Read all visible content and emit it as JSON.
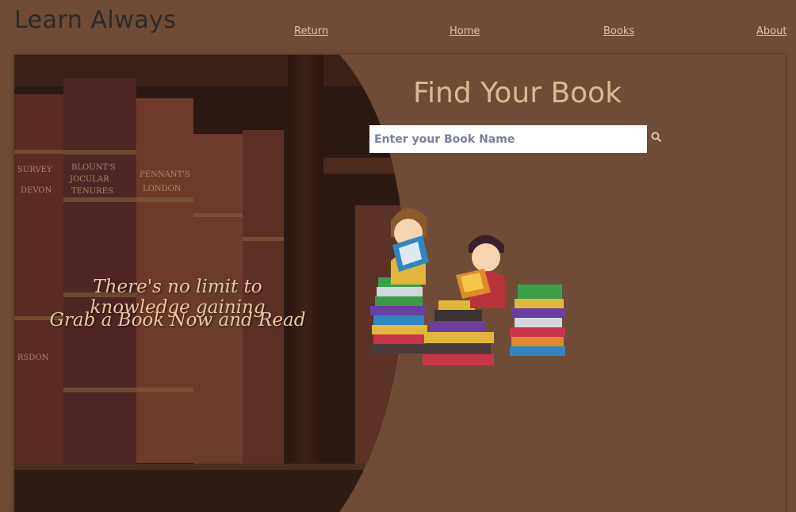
{
  "brand": "Learn Always",
  "nav": {
    "return": "Return",
    "home": "Home",
    "books": "Books",
    "about": "About"
  },
  "hero": {
    "line1": "There's no limit to knowledge gaining",
    "line2": "Grab a Book Now and Read"
  },
  "search": {
    "title": "Find Your Book",
    "placeholder": "Enter your Book Name",
    "value": ""
  },
  "icons": {
    "search": "search-icon"
  },
  "colors": {
    "background": "#6f4c37",
    "title": "#ddb898",
    "link": "#d9c6b3",
    "brand": "#2d2a2a"
  }
}
